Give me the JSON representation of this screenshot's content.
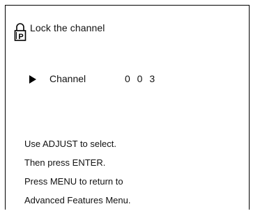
{
  "header": {
    "icon": "lock-icon",
    "icon_letter": "P",
    "title": "Lock the channel"
  },
  "channel_row": {
    "pointer_icon": "triangle-pointer-icon",
    "label": "Channel",
    "value": "0 0 3"
  },
  "instructions": [
    "Use ADJUST to select.",
    "Then press ENTER.",
    "Press MENU to return to",
    "Advanced Features Menu."
  ]
}
